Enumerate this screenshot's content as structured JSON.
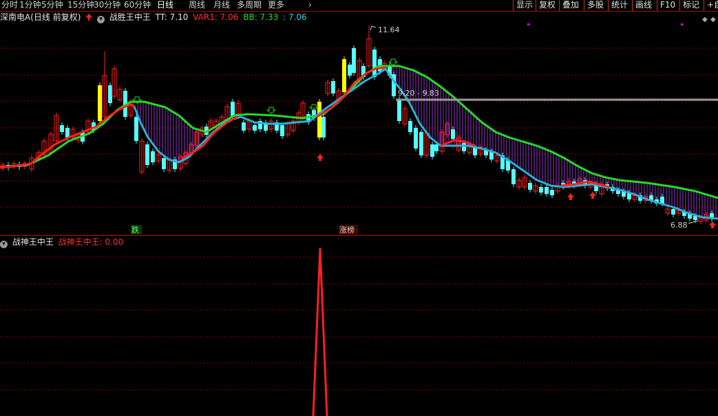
{
  "toolbar": {
    "periods": [
      "分时",
      "1分钟",
      "5分钟",
      "15分钟",
      "30分钟",
      "60分钟",
      "日线",
      "周线",
      "月线",
      "多周期",
      "更多"
    ],
    "active_period": "日线",
    "more_arrow": "›",
    "right_buttons": [
      "显示",
      "复权",
      "叠加",
      "多股",
      "统计",
      "画线",
      "F10",
      "标记"
    ],
    "extra": "+自"
  },
  "main_panel": {
    "stock_title": "深南电A(日线 前复权)",
    "up_arrow_icon": "red-up-arrow",
    "indicator_name": "战胜王中王",
    "tt_label": "TT: 7.10",
    "var1_label": "VAR1: 7.06",
    "bb_label": "BB: 7.33",
    "bb_value2": ": 7.06",
    "high_label": "11.64",
    "range_label": "9.20 - 9.83",
    "low_label": "6.88",
    "fall_tag": "跌",
    "limit_up_tag": "涨榜"
  },
  "sub_panel": {
    "indicator_name": "战神王中王",
    "value_label": "战神王中王: 0.00"
  },
  "colors": {
    "up": "#ff2020",
    "down": "#54ffff",
    "ma_green": "#22dd22",
    "ma_red": "#ff2020",
    "ma_cyan": "#2bb0d6",
    "grid": "#8a0000",
    "fill": "#c040ff",
    "yellow": "#ffff00",
    "spike": "#ff2020"
  }
}
